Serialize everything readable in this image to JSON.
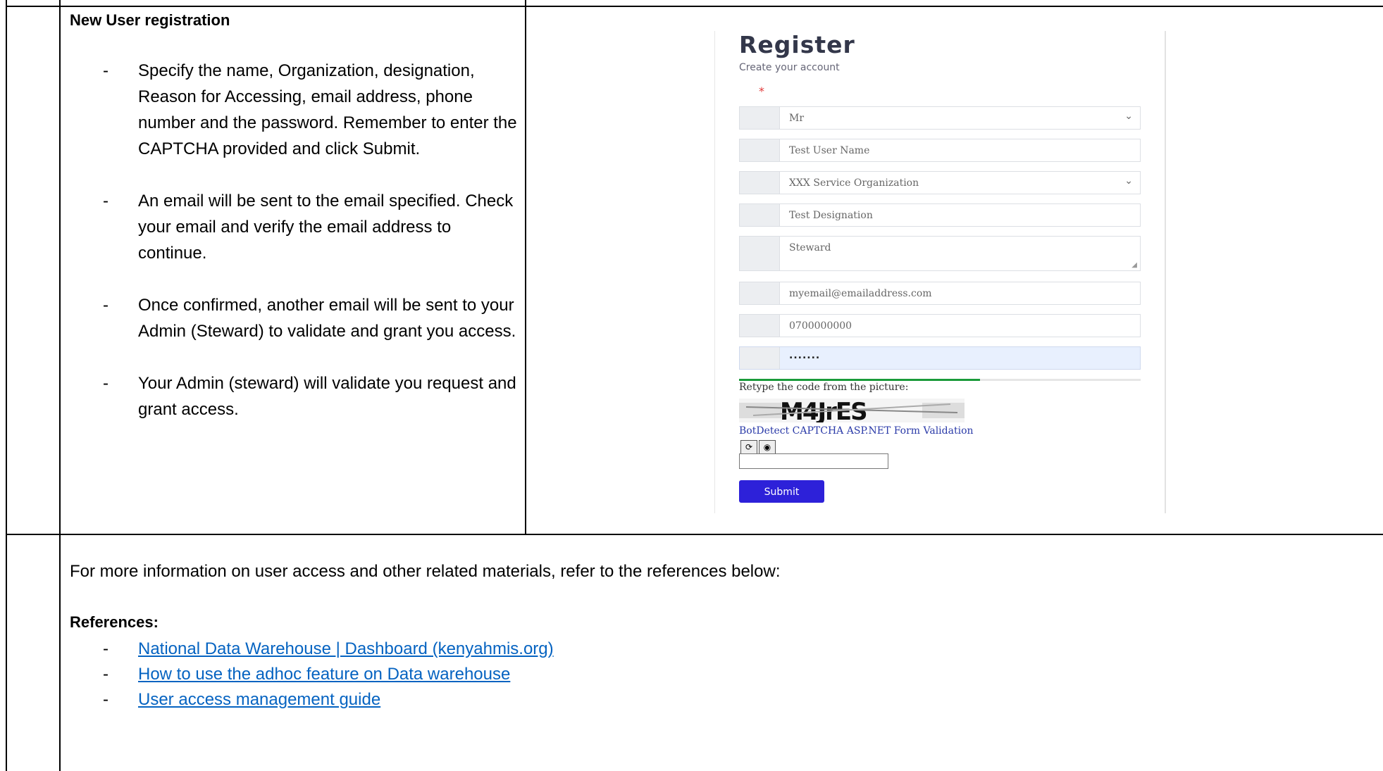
{
  "section": {
    "title": "New User registration",
    "bullets": [
      "Specify the name, Organization, designation, Reason for Accessing, email address, phone number and the password. Remember to enter the CAPTCHA provided and click Submit.",
      "An email will be sent to the email specified. Check your email and verify the email address to continue.",
      "Once confirmed, another email will be sent to your Admin (Steward) to validate and grant you access.",
      "Your Admin (steward) will validate you request and grant access."
    ],
    "dash": "-"
  },
  "form": {
    "title": "Register",
    "subtitle": "Create your account",
    "required_mark": "*",
    "salutation": "Mr",
    "name": "Test User Name",
    "organization": "XXX Service Organization",
    "designation": "Test Designation",
    "reason": "Steward",
    "email": "myemail@emailaddress.com",
    "phone": "0700000000",
    "password_mask": ".......",
    "retype_label": "Retype the code from the picture:",
    "captcha_text": "BotDetect CAPTCHA ASP.NET Form Validation",
    "submit_label": "Submit",
    "chevron": "⌄",
    "password_strength": 0.6
  },
  "footer": {
    "intro": "For more information on user access and other related materials, refer to the references below:",
    "references_title": "References:",
    "references": [
      "National Data Warehouse | Dashboard (kenyahmis.org)",
      "How to use the adhoc feature on Data warehouse",
      "User access management guide"
    ]
  }
}
